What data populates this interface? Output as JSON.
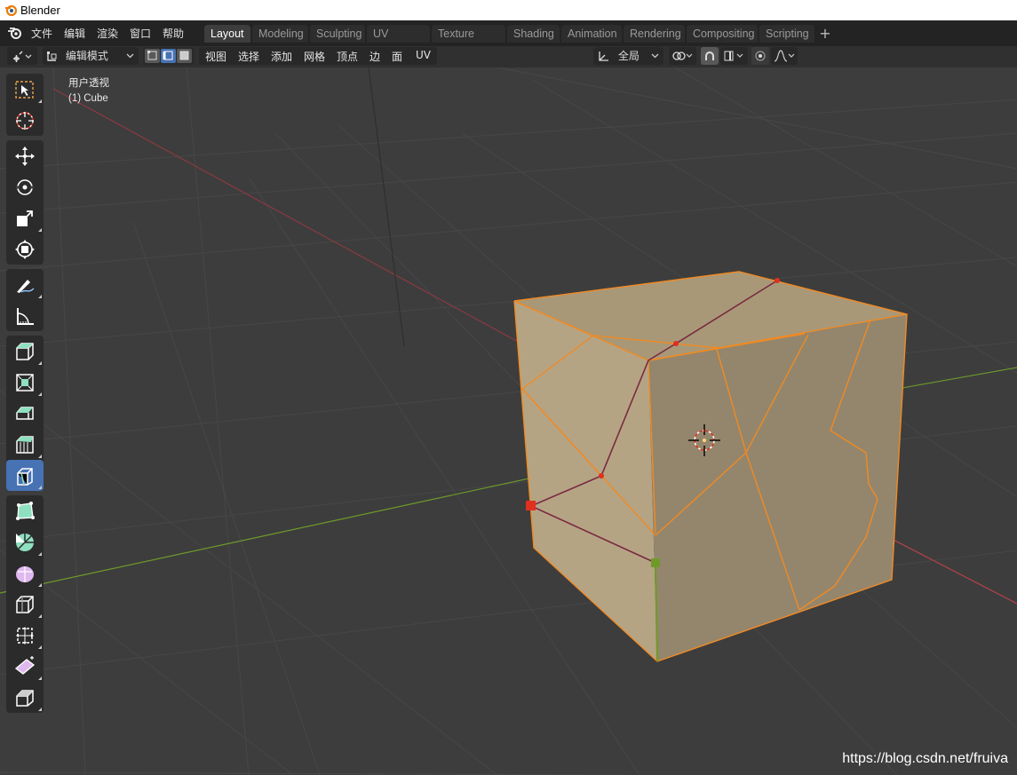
{
  "window": {
    "title": "Blender"
  },
  "menubar": {
    "items": [
      "文件",
      "编辑",
      "渲染",
      "窗口",
      "帮助"
    ]
  },
  "workspaces": {
    "active": "Layout",
    "tabs": [
      "Layout",
      "Modeling",
      "Sculpting",
      "UV Editing",
      "Texture Paint",
      "Shading",
      "Animation",
      "Rendering",
      "Compositing",
      "Scripting"
    ]
  },
  "header": {
    "mode": "编辑模式",
    "menus": [
      "视图",
      "选择",
      "添加",
      "网格",
      "顶点",
      "边",
      "面",
      "UV"
    ],
    "transform_orientation": "全局"
  },
  "viewport": {
    "view_name": "用户透视",
    "object_name": "(1) Cube",
    "watermark": "https://blog.csdn.net/fruiva"
  },
  "toolbar": {
    "tools": [
      "select-box",
      "cursor",
      "move",
      "rotate",
      "scale",
      "transform",
      "annotate",
      "measure",
      "add-cube",
      "extrude-region",
      "inset-faces",
      "bevel",
      "loop-cut",
      "knife",
      "poly-build",
      "spin",
      "smooth",
      "edge-slide",
      "shrink-fatten",
      "shear",
      "rip-region"
    ],
    "active_tool": "knife"
  },
  "colors": {
    "accent": "#4772b3",
    "edge_selected": "#f08a24",
    "face_fill": "#9d8f76",
    "axis_x": "#b5414a",
    "axis_y": "#6f9a2a"
  }
}
